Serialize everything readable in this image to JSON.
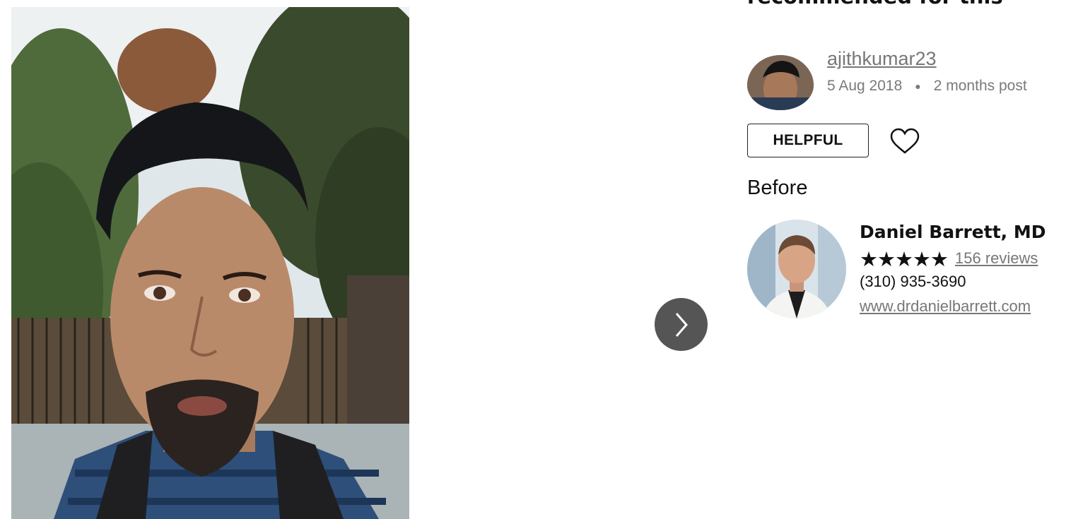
{
  "title": {
    "line1": "",
    "line2": "recommended for this"
  },
  "author": {
    "username": "ajithkumar23",
    "date": "5 Aug 2018",
    "age": "2 months post"
  },
  "actions": {
    "helpful_label": "HELPFUL",
    "heart_icon": "heart-outline-icon"
  },
  "photo": {
    "label": "Before"
  },
  "doctor": {
    "name": "Daniel Barrett, MD",
    "stars": "★★★★★",
    "rating": 5,
    "reviews": "156 reviews",
    "phone": "(310) 935-3690",
    "website": "www.drdanielbarrett.com"
  },
  "navigation": {
    "next_icon": "chevron-right-icon"
  },
  "colors": {
    "link_gray": "#777777",
    "next_button": "#555555",
    "text": "#111111"
  }
}
